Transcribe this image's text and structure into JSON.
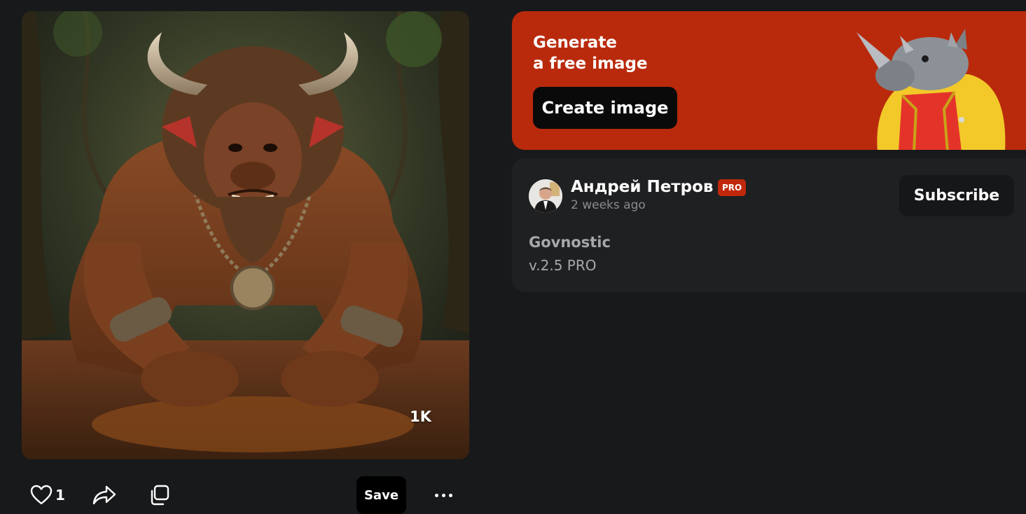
{
  "artwork": {
    "resolution_badge": "1K"
  },
  "actions": {
    "like_count": "1",
    "save_label": "Save"
  },
  "promo": {
    "title": "Generate\na free image",
    "button_label": "Create image"
  },
  "author": {
    "name": "Андрей Петров",
    "badge": "PRO",
    "posted": "2 weeks ago",
    "subscribe_label": "Subscribe"
  },
  "model": {
    "name": "Govnostic",
    "version": "v.2.5 PRO"
  },
  "colors": {
    "page_bg": "#18191b",
    "card_bg": "#1f2022",
    "promo_bg": "#b92a0c",
    "pro_badge": "#c0280c",
    "button_dark": "#000000"
  },
  "icons": [
    "heart-icon",
    "share-icon",
    "copy-icon",
    "more-icon"
  ]
}
